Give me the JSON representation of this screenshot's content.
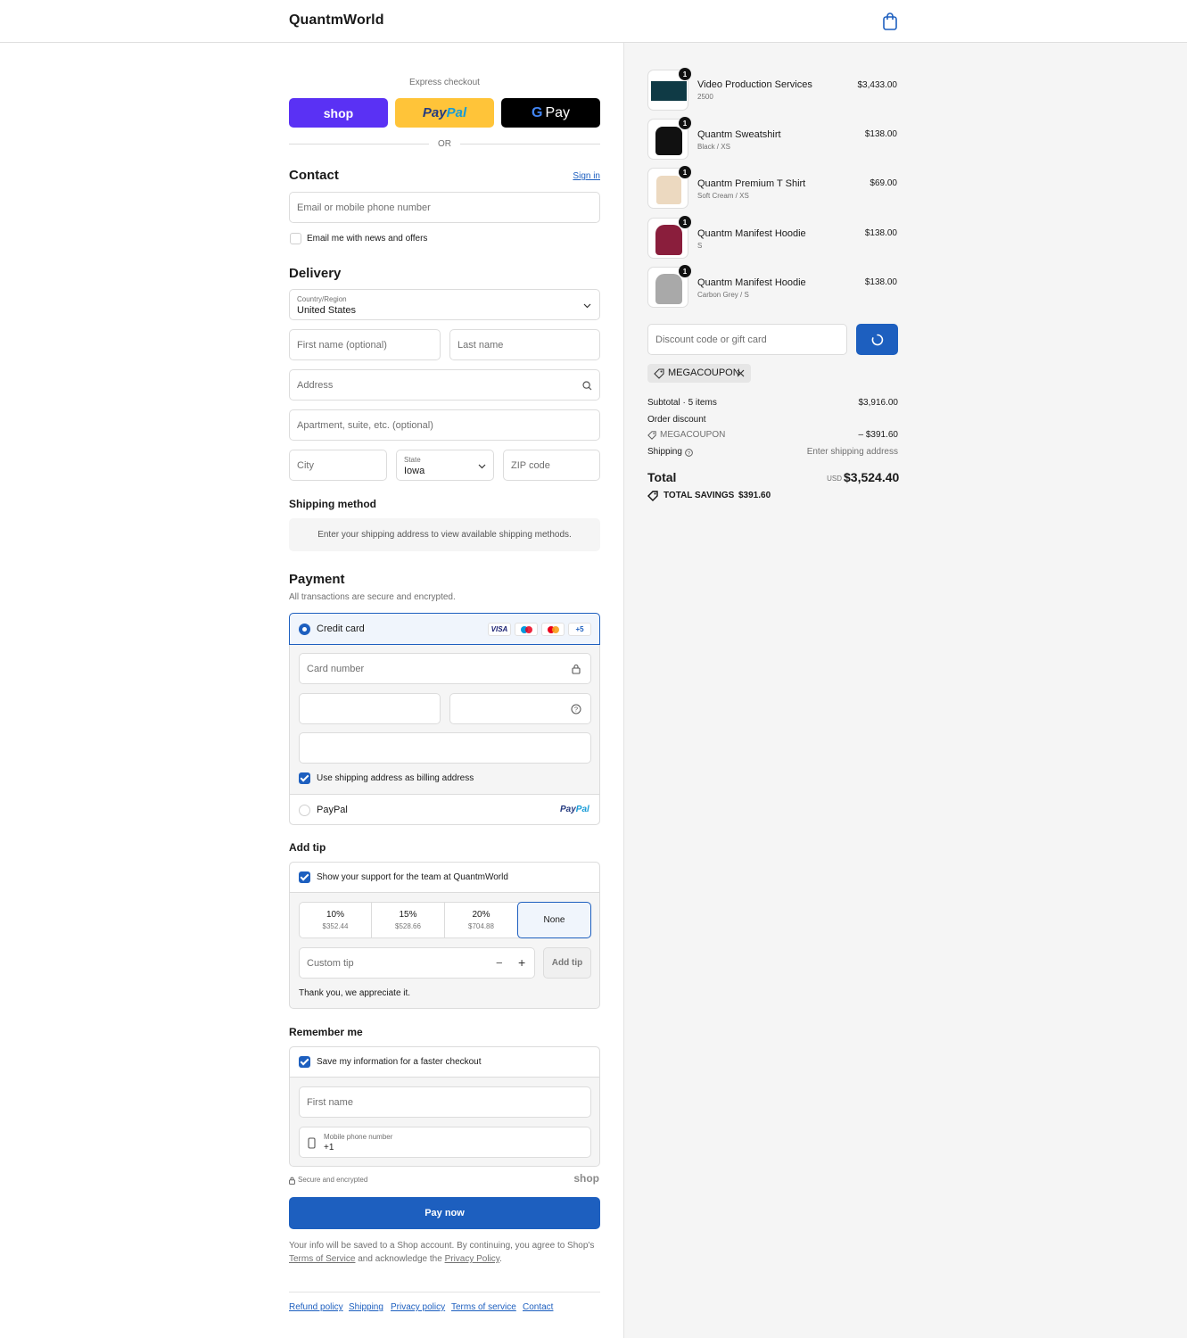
{
  "header": {
    "brand": "QuantmWorld",
    "cart_icon": "shopping-bag-icon"
  },
  "express": {
    "label": "Express checkout",
    "shop_label": "shop",
    "paypal_label_a": "Pay",
    "paypal_label_b": "Pal",
    "gpay_g": "G",
    "gpay_label": "Pay",
    "or_label": "OR"
  },
  "contact": {
    "title": "Contact",
    "sign_in": "Sign in",
    "email_placeholder": "Email or mobile phone number",
    "news_label": "Email me with news and offers"
  },
  "delivery": {
    "title": "Delivery",
    "country_label": "Country/Region",
    "country_value": "United States",
    "first_name_placeholder": "First name (optional)",
    "last_name_placeholder": "Last name",
    "address_placeholder": "Address",
    "apartment_placeholder": "Apartment, suite, etc. (optional)",
    "city_placeholder": "City",
    "state_label": "State",
    "state_value": "Iowa",
    "zip_placeholder": "ZIP code"
  },
  "shipping_method": {
    "title": "Shipping method",
    "message": "Enter your shipping address to view available shipping methods."
  },
  "payment": {
    "title": "Payment",
    "subtitle": "All transactions are secure and encrypted.",
    "credit_card_label": "Credit card",
    "visa_label": "VISA",
    "more_cards": "+5",
    "card_number_placeholder": "Card number",
    "billing_label": "Use shipping address as billing address",
    "paypal_label": "PayPal",
    "paypal_logo_a": "Pay",
    "paypal_logo_b": "Pal"
  },
  "tip": {
    "title": "Add tip",
    "support_label": "Show your support for the team at QuantmWorld",
    "options": [
      {
        "pct": "10%",
        "amount": "$352.44"
      },
      {
        "pct": "15%",
        "amount": "$528.66"
      },
      {
        "pct": "20%",
        "amount": "$704.88"
      },
      {
        "pct": "None",
        "amount": ""
      }
    ],
    "custom_placeholder": "Custom tip",
    "minus": "−",
    "plus": "+",
    "add_button": "Add tip",
    "thanks": "Thank you, we appreciate it."
  },
  "remember": {
    "title": "Remember me",
    "save_label": "Save my information for a faster checkout",
    "first_name_placeholder": "First name",
    "phone_label": "Mobile phone number",
    "phone_value": "+1",
    "secure_label": "Secure and encrypted",
    "shop_logo": "shop"
  },
  "pay_button": "Pay now",
  "legal": {
    "line1": "Your info will be saved to a Shop account. By continuing, you agree to Shop's",
    "terms": "Terms of Service",
    "middle": "and acknowledge the",
    "privacy": "Privacy Policy",
    "end": "."
  },
  "footer_links": [
    "Refund policy",
    "Shipping",
    "Privacy policy",
    "Terms of service",
    "Contact"
  ],
  "order": {
    "items": [
      {
        "name": "Video Production Services",
        "variant": "2500",
        "price": "$3,433.00",
        "qty": "1"
      },
      {
        "name": "Quantm Sweatshirt",
        "variant": "Black / XS",
        "price": "$138.00",
        "qty": "1"
      },
      {
        "name": "Quantm Premium T Shirt",
        "variant": "Soft Cream / XS",
        "price": "$69.00",
        "qty": "1"
      },
      {
        "name": "Quantm Manifest Hoodie",
        "variant": "S",
        "price": "$138.00",
        "qty": "1"
      },
      {
        "name": "Quantm Manifest Hoodie",
        "variant": "Carbon Grey / S",
        "price": "$138.00",
        "qty": "1"
      }
    ],
    "discount_placeholder": "Discount code or gift card",
    "coupon_tag": "MEGACOUPON",
    "subtotal_label": "Subtotal · 5 items",
    "subtotal_value": "$3,916.00",
    "order_discount_label": "Order discount",
    "discount_code": "MEGACOUPON",
    "discount_value": "– $391.60",
    "shipping_label": "Shipping",
    "shipping_value": "Enter shipping address",
    "total_label": "Total",
    "currency": "USD",
    "total_value": "$3,524.40",
    "savings_label": "TOTAL SAVINGS",
    "savings_value": "$391.60"
  },
  "colors": {
    "accent": "#1d5fbf",
    "shop": "#5a31f4",
    "paypal": "#ffc439",
    "gpay": "#000000"
  }
}
